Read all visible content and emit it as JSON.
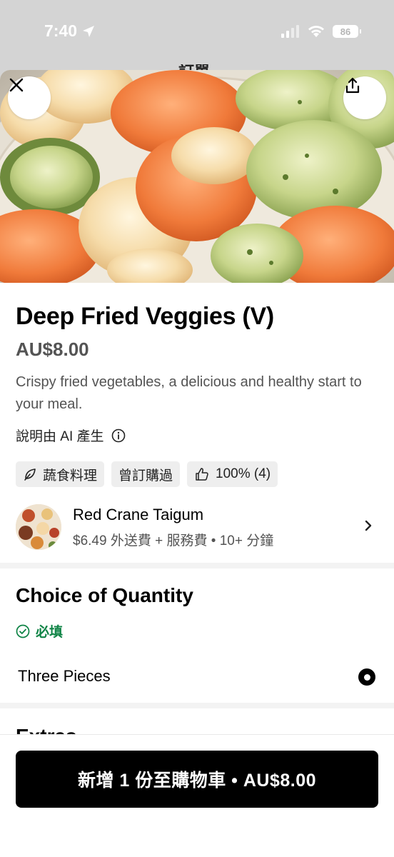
{
  "status_bar": {
    "time": "7:40",
    "battery": "86"
  },
  "background_screen": {
    "title": "訂單"
  },
  "item": {
    "name": "Deep Fried Veggies (V)",
    "price": "AU$8.00",
    "description": "Crispy fried vegetables, a delicious and healthy start to your meal.",
    "ai_note": "說明由 AI 產生",
    "tags": [
      {
        "icon": "leaf-icon",
        "label": "蔬食料理"
      },
      {
        "icon": "",
        "label": "曾訂購過"
      },
      {
        "icon": "thumbs-up-icon",
        "label": "100% (4)"
      }
    ]
  },
  "restaurant": {
    "name": "Red Crane Taigum",
    "meta": "$6.49 外送費 + 服務費 • 10+ 分鐘"
  },
  "options": {
    "section_title": "Choice of Quantity",
    "required_label": "必填",
    "choices": [
      {
        "label": "Three Pieces",
        "selected": true
      }
    ],
    "next_section_peek": "Extras"
  },
  "cart_button": {
    "label": "新增 1 份至購物車 • AU$8.00"
  },
  "colors": {
    "required_green": "#0e8345",
    "price_gray": "#545454",
    "cta_bg": "#000000"
  }
}
